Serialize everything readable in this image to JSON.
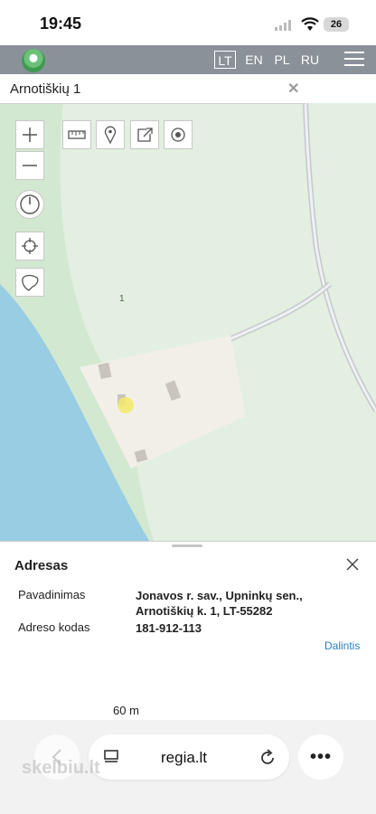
{
  "status": {
    "time": "19:45",
    "battery": "26"
  },
  "header": {
    "languages": [
      "LT",
      "EN",
      "PL",
      "RU"
    ],
    "active_language": "LT"
  },
  "search": {
    "value": "Arnotiškių 1"
  },
  "map": {
    "parcel_label": "1"
  },
  "panel": {
    "title": "Adresas",
    "name_label": "Pavadinimas",
    "name_value_line1": "Jonavos r. sav., Upninkų sen.,",
    "name_value_line2": "Arnotiškių k. 1, LT-55282",
    "code_label": "Adreso kodas",
    "code_value": "181-912-113",
    "share_label": "Dalintis",
    "scale_label": "60 m"
  },
  "browser": {
    "url": "regia.lt",
    "watermark": "skelbiu.lt"
  },
  "colors": {
    "header_bg": "#8a9199",
    "water": "#98cde3",
    "forest": "#d3e8d0",
    "meadow": "#e3efe1",
    "parcel": "#f2efe9",
    "link": "#2a7fc0"
  }
}
